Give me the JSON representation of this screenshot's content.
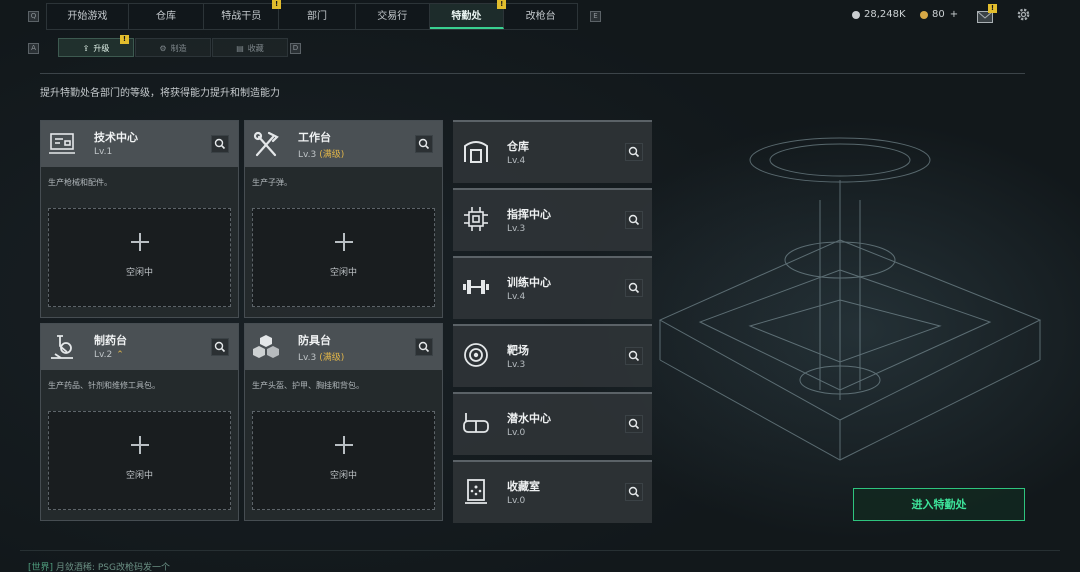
{
  "nav": {
    "left_key": "Q",
    "right_key": "E",
    "tabs": [
      {
        "label": "开始游戏",
        "badge": ""
      },
      {
        "label": "仓库",
        "badge": ""
      },
      {
        "label": "特战干员",
        "badge": "!"
      },
      {
        "label": "部门",
        "badge": ""
      },
      {
        "label": "交易行",
        "badge": ""
      },
      {
        "label": "特勤处",
        "badge": "!"
      },
      {
        "label": "改枪台",
        "badge": ""
      }
    ],
    "active_tab": "特勤处"
  },
  "currency": {
    "silver": "28,248K",
    "gold": "80",
    "gold_plus": "+"
  },
  "mail_badge": "!",
  "subtabs": {
    "left_key": "A",
    "right_key": "D",
    "items": [
      {
        "label": "升级",
        "badge": "!"
      },
      {
        "label": "制造",
        "badge": ""
      },
      {
        "label": "收藏",
        "badge": ""
      }
    ]
  },
  "description": "提升特勤处各部门的等级，将获得能力提升和制造能力",
  "production": [
    {
      "title": "技术中心",
      "level": "Lv.1",
      "extra": "",
      "desc": "生产枪械和配件。",
      "slot": "空闲中",
      "icon": "tech-center-icon"
    },
    {
      "title": "工作台",
      "level": "Lv.3",
      "extra": "(满级)",
      "desc": "生产子弹。",
      "slot": "空闲中",
      "icon": "workbench-icon"
    },
    {
      "title": "制药台",
      "level": "Lv.2",
      "extra": "",
      "desc": "生产药品、针剂和维修工具包。",
      "slot": "空闲中",
      "icon": "pharmacy-icon"
    },
    {
      "title": "防具台",
      "level": "Lv.3",
      "extra": "(满级)",
      "desc": "生产头盔、护甲、胸挂和背包。",
      "slot": "空闲中",
      "icon": "armor-bench-icon"
    }
  ],
  "facilities": [
    {
      "title": "仓库",
      "level": "Lv.4",
      "icon": "warehouse-icon"
    },
    {
      "title": "指挥中心",
      "level": "Lv.3",
      "icon": "command-center-icon"
    },
    {
      "title": "训练中心",
      "level": "Lv.4",
      "icon": "training-center-icon"
    },
    {
      "title": "靶场",
      "level": "Lv.3",
      "icon": "shooting-range-icon"
    },
    {
      "title": "潜水中心",
      "level": "Lv.0",
      "icon": "diving-center-icon"
    },
    {
      "title": "收藏室",
      "level": "Lv.0",
      "icon": "collection-room-icon"
    }
  ],
  "enter_button": "进入特勤处",
  "chat": {
    "channel": "[世界]",
    "user": "月敛酒稀:",
    "message": "PSG改枪码发一个"
  },
  "colors": {
    "accent": "#39d191",
    "badge": "#e2bd2d",
    "max_level": "#e0b54a"
  }
}
